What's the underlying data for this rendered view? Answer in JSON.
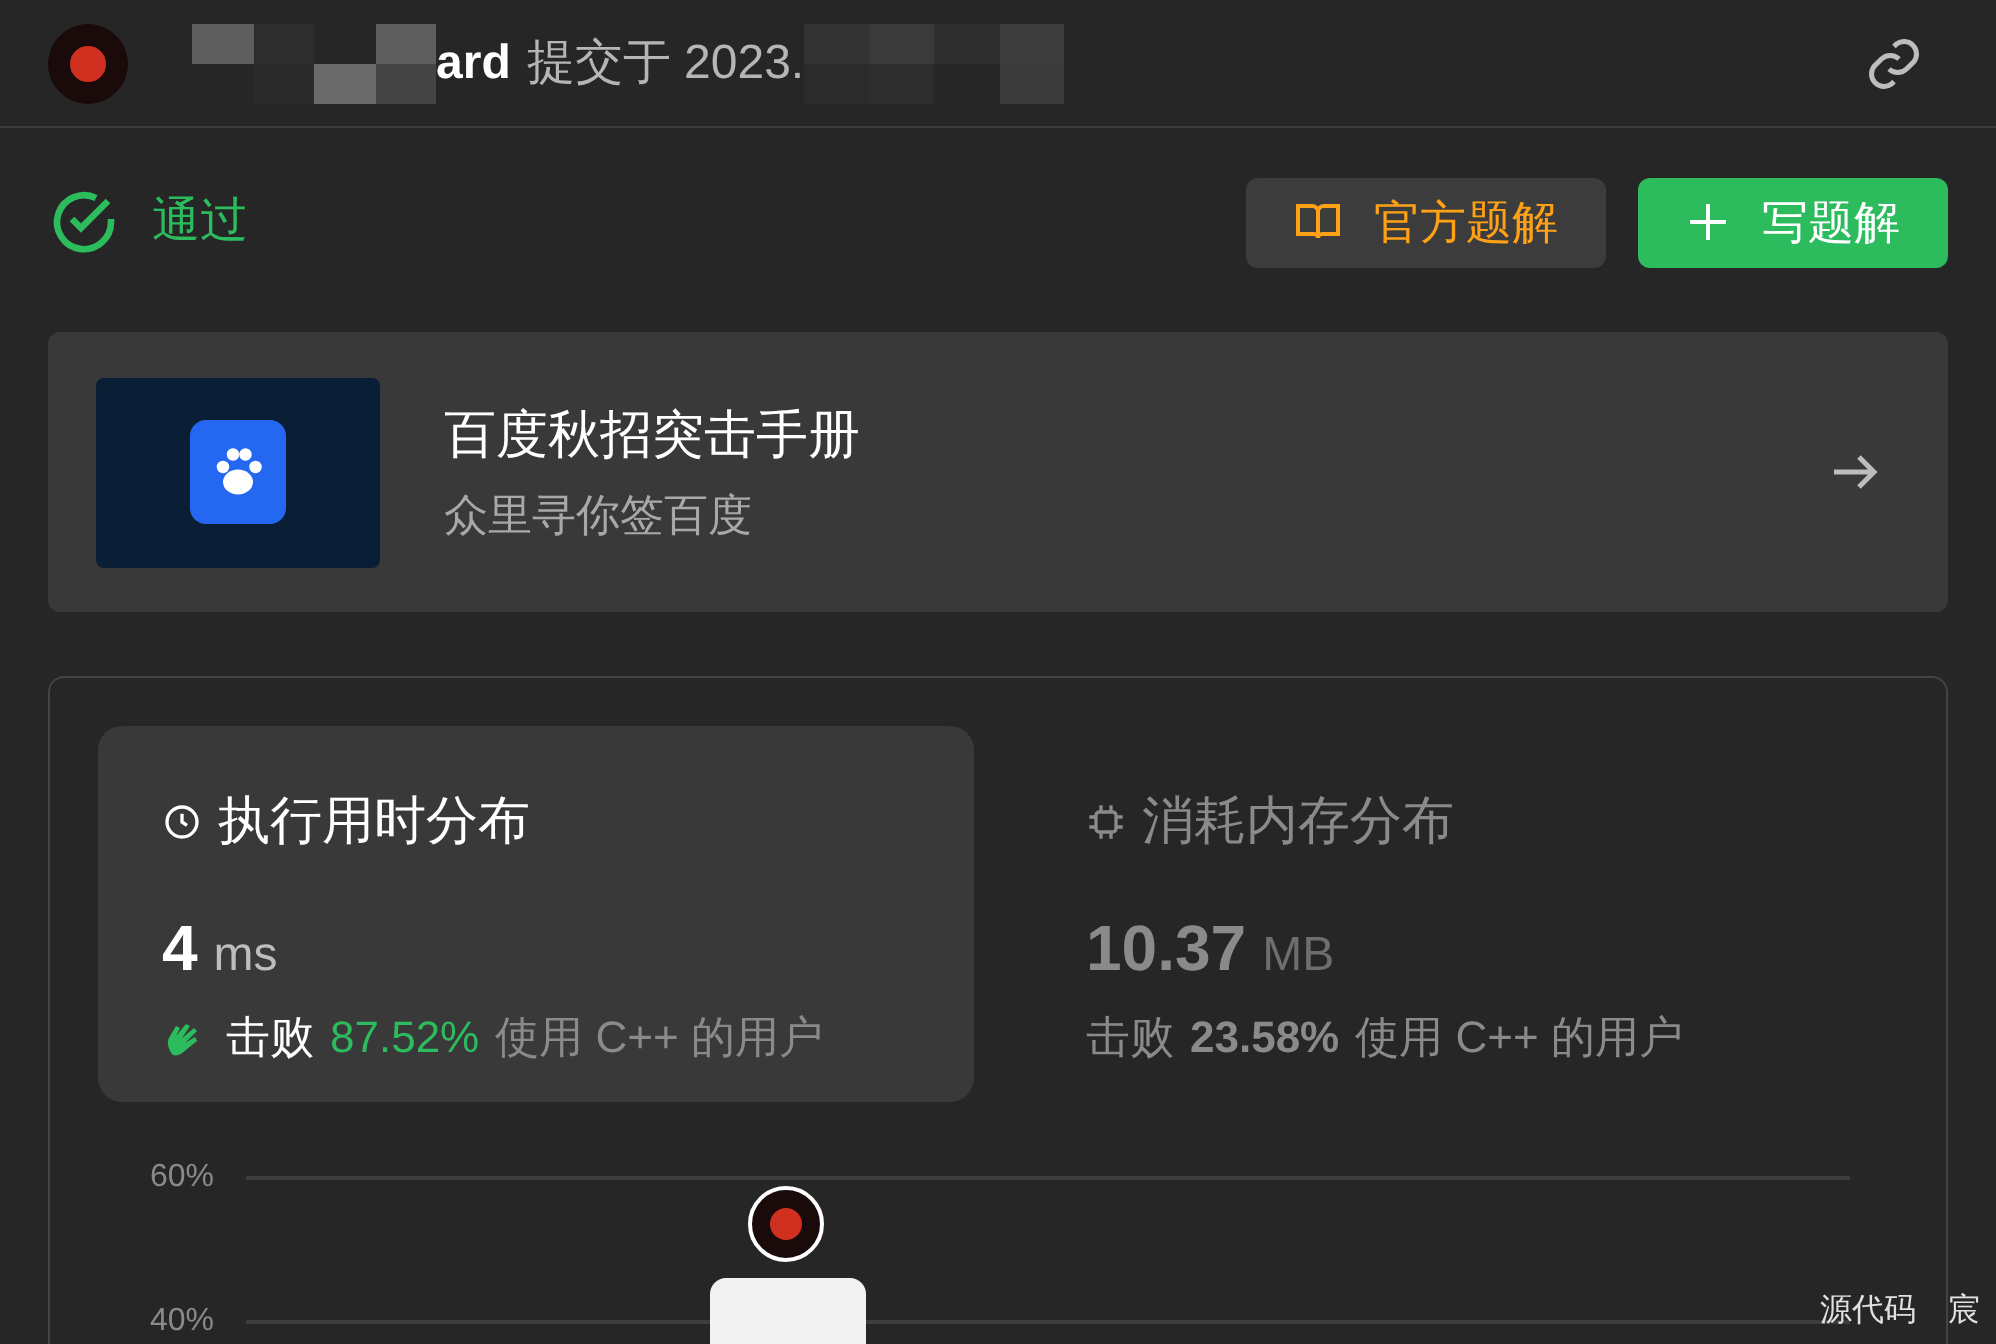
{
  "header": {
    "author_visible": "ard",
    "submitted_text": "提交于 2023."
  },
  "status": {
    "label": "通过",
    "passed": true
  },
  "actions": [
    {
      "label": "官方题解",
      "kind": "book"
    },
    {
      "label": "写题解",
      "kind": "add"
    }
  ],
  "banner": {
    "title": "百度秋招突击手册",
    "subtitle": "众里寻你签百度"
  },
  "stats": [
    {
      "kind": "time",
      "title": "执行用时分布",
      "value": "4",
      "unit": "ms",
      "beat_label": "击败",
      "percent": "87.52%",
      "suffix": "使用 C++ 的用户",
      "selected": true
    },
    {
      "kind": "memory",
      "title": "消耗内存分布",
      "value": "10.37",
      "unit": "MB",
      "beat_label": "击败",
      "percent": "23.58%",
      "suffix": "使用 C++ 的用户",
      "selected": false
    }
  ],
  "chart": {
    "y_axis_labels": [
      "60%",
      "40%"
    ]
  },
  "overlay_text": [
    "源代码",
    "宸"
  ]
}
